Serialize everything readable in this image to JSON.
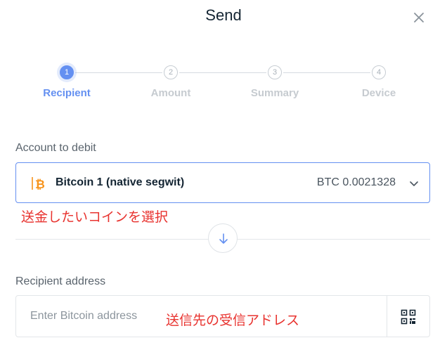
{
  "modal": {
    "title": "Send"
  },
  "stepper": {
    "steps": [
      {
        "number": "1",
        "label": "Recipient",
        "active": true
      },
      {
        "number": "2",
        "label": "Amount",
        "active": false
      },
      {
        "number": "3",
        "label": "Summary",
        "active": false
      },
      {
        "number": "4",
        "label": "Device",
        "active": false
      }
    ]
  },
  "account": {
    "label": "Account to debit",
    "name": "Bitcoin 1 (native segwit)",
    "balance": "BTC 0.0021328",
    "icon": "bitcoin-icon"
  },
  "annotations": {
    "select_coin": "送金したいコインを選択",
    "recipient_address": "送信先の受信アドレス"
  },
  "recipient": {
    "label": "Recipient address",
    "placeholder": "Enter Bitcoin address",
    "qr_icon": "qr-code-icon"
  },
  "colors": {
    "accent": "#6490f1",
    "bitcoin": "#f7931a",
    "annotation": "#e8332f",
    "text": "#142533"
  }
}
